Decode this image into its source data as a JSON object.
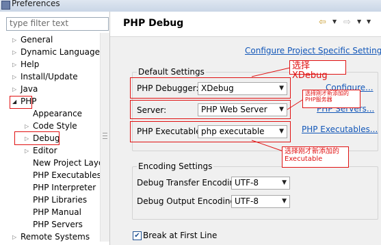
{
  "window": {
    "title": "Preferences"
  },
  "filter": {
    "placeholder": "type filter text"
  },
  "tree": {
    "general": "General",
    "dynamic_languages": "Dynamic Languages",
    "help": "Help",
    "install_update": "Install/Update",
    "java": "Java",
    "php": "PHP",
    "appearance": "Appearance",
    "code_style": "Code Style",
    "debug": "Debug",
    "editor": "Editor",
    "new_project_layout": "New Project Layou",
    "php_executables": "PHP Executables",
    "php_interpreter": "PHP Interpreter",
    "php_libraries": "PHP Libraries",
    "php_manual": "PHP Manual",
    "php_servers": "PHP Servers",
    "remote_systems": "Remote Systems"
  },
  "page": {
    "title": "PHP Debug",
    "configure_project_link": "Configure Project Specific Settings...",
    "default_settings": {
      "label": "Default Settings",
      "debugger_label": "PHP Debugger:",
      "debugger_value": "XDebug",
      "configure_link": "Configure...",
      "server_label": "Server:",
      "server_value": "PHP Web Server",
      "servers_link": "PHP Servers...",
      "executable_label": "PHP Executable:",
      "executable_value": "php executable",
      "executables_link": "PHP Executables..."
    },
    "encoding_settings": {
      "label": "Encoding Settings",
      "transfer_label": "Debug Transfer Encoding",
      "transfer_value": "UTF-8",
      "output_label": "Debug Output Encoding",
      "output_value": "UTF-8"
    },
    "break_first_line": {
      "label": "Break at First Line",
      "checked": true
    }
  },
  "annotations": {
    "select_xdebug": "选择XDebug",
    "server_note": "选择刚才新添加的PHP服务器",
    "executable_note_line1": "选择刚才新添加的",
    "executable_note_line2": "Executable"
  },
  "colors": {
    "annotation": "#e01010",
    "link": "#1156b8"
  }
}
